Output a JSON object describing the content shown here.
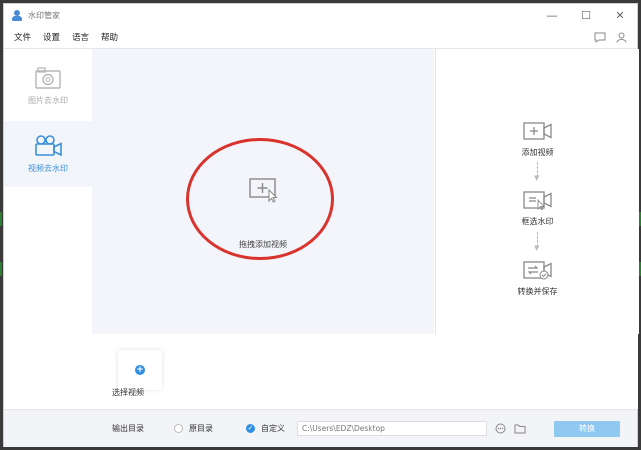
{
  "window": {
    "title": "水印管家"
  },
  "menu": {
    "items": [
      "文件",
      "设置",
      "语言",
      "帮助"
    ]
  },
  "sidebar": {
    "items": [
      {
        "label": "图片去水印",
        "icon": "camera-icon"
      },
      {
        "label": "视频去水印",
        "icon": "video-camera-icon"
      }
    ]
  },
  "drop": {
    "label": "拖拽添加视频"
  },
  "steps": [
    {
      "label": "添加视频",
      "icon": "add-video-icon"
    },
    {
      "label": "框选水印",
      "icon": "select-watermark-icon"
    },
    {
      "label": "转换并保存",
      "icon": "convert-save-icon"
    }
  ],
  "select": {
    "label": "选择视频"
  },
  "output": {
    "label": "输出目录",
    "option_original": "原目录",
    "option_custom": "自定义",
    "path": "C:\\Users\\EDZ\\Desktop",
    "convert_label": "转换"
  },
  "colors": {
    "accent": "#2f8fe0",
    "annotation": "#d9332e",
    "drop_bg": "#f3f5fa"
  }
}
